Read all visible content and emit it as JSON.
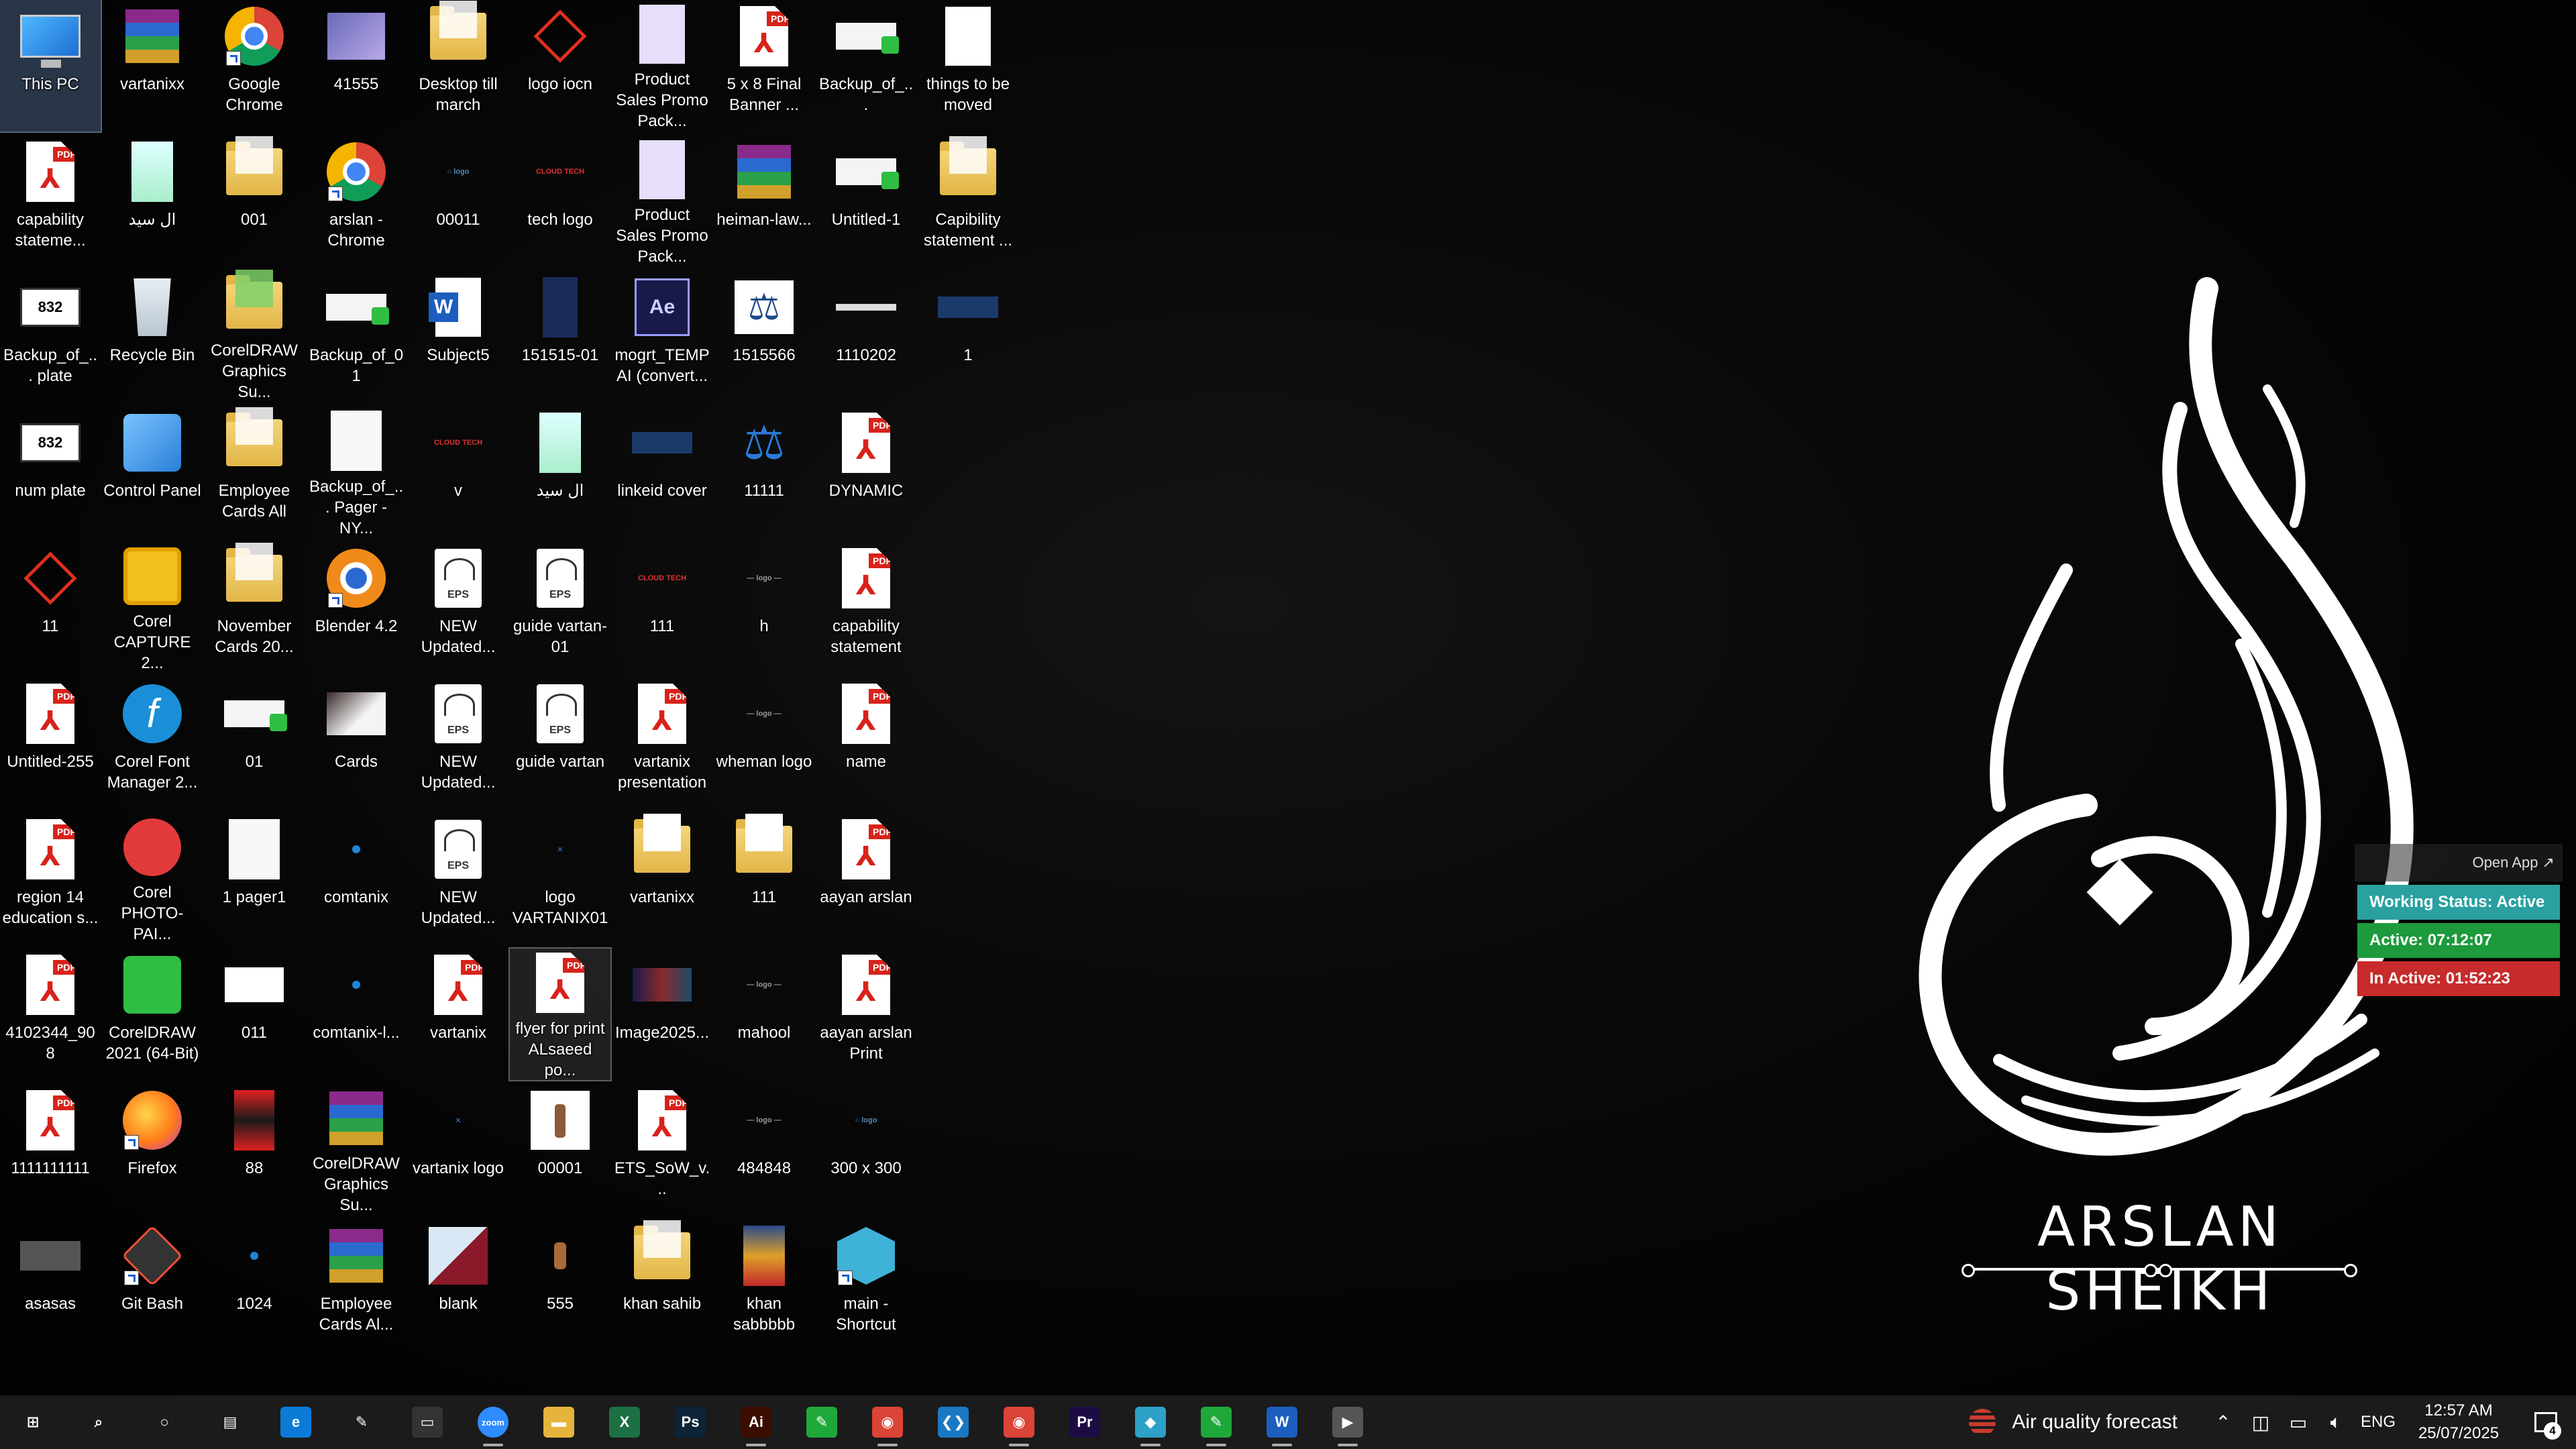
{
  "desktop": {
    "icons": [
      {
        "label": "This PC",
        "type": "pc",
        "col": 0,
        "row": 0,
        "selected": true
      },
      {
        "label": "vartanixx",
        "type": "rar",
        "col": 1,
        "row": 0
      },
      {
        "label": "Google Chrome",
        "type": "chrome",
        "col": 2,
        "row": 0,
        "shortcut": true
      },
      {
        "label": "41555",
        "type": "thumb-purple",
        "col": 3,
        "row": 0
      },
      {
        "label": "Desktop till march",
        "type": "folder",
        "col": 4,
        "row": 0
      },
      {
        "label": "logo iocn",
        "type": "logo-red",
        "col": 5,
        "row": 0
      },
      {
        "label": "Product Sales Promo Pack...",
        "type": "doc-lilac",
        "col": 6,
        "row": 0
      },
      {
        "label": "5 x 8 Final Banner ...",
        "type": "pdf",
        "col": 7,
        "row": 0
      },
      {
        "label": "Backup_of_...",
        "type": "thumb-cdr",
        "col": 8,
        "row": 0
      },
      {
        "label": "things to be moved",
        "type": "doc",
        "col": 9,
        "row": 0
      },
      {
        "label": "capability stateme...",
        "type": "pdf",
        "col": 0,
        "row": 1
      },
      {
        "label": "ال سيد",
        "type": "thumb-flyer",
        "col": 1,
        "row": 1
      },
      {
        "label": "001",
        "type": "folder",
        "col": 2,
        "row": 1
      },
      {
        "label": "arslan - Chrome",
        "type": "chrome",
        "col": 3,
        "row": 1,
        "shortcut": true
      },
      {
        "label": "00011",
        "type": "tiny-logo",
        "col": 4,
        "row": 1
      },
      {
        "label": "tech logo",
        "type": "tiny-red",
        "col": 5,
        "row": 1
      },
      {
        "label": "Product Sales Promo Pack...",
        "type": "doc-lilac",
        "col": 6,
        "row": 1
      },
      {
        "label": "heiman-law...",
        "type": "rar",
        "col": 7,
        "row": 1
      },
      {
        "label": "Untitled-1",
        "type": "thumb-cdr",
        "col": 8,
        "row": 1
      },
      {
        "label": "Capibility statement ...",
        "type": "folder",
        "col": 9,
        "row": 1
      },
      {
        "label": "Backup_of_... plate",
        "type": "thumb-plate",
        "col": 0,
        "row": 2
      },
      {
        "label": "Recycle Bin",
        "type": "bin",
        "col": 1,
        "row": 2
      },
      {
        "label": "CorelDRAW Graphics Su...",
        "type": "folder-blue",
        "col": 2,
        "row": 2
      },
      {
        "label": "Backup_of_01",
        "type": "thumb-cdr",
        "col": 3,
        "row": 2
      },
      {
        "label": "Subject5",
        "type": "word",
        "col": 4,
        "row": 2
      },
      {
        "label": "151515-01",
        "type": "thumb-navy",
        "col": 5,
        "row": 2
      },
      {
        "label": "mogrt_TEMP AI (convert...",
        "type": "ae",
        "col": 6,
        "row": 2
      },
      {
        "label": "1515566",
        "type": "scales-white",
        "col": 7,
        "row": 2
      },
      {
        "label": "1110202",
        "type": "thumb-line",
        "col": 8,
        "row": 2
      },
      {
        "label": "1",
        "type": "thumb-banner",
        "col": 9,
        "row": 2
      },
      {
        "label": "num plate",
        "type": "thumb-plate",
        "col": 0,
        "row": 3
      },
      {
        "label": "Control Panel",
        "type": "control",
        "col": 1,
        "row": 3
      },
      {
        "label": "Employee Cards All",
        "type": "folder",
        "col": 2,
        "row": 3
      },
      {
        "label": "Backup_of_... Pager - NY...",
        "type": "thumb-page",
        "col": 3,
        "row": 3
      },
      {
        "label": "v",
        "type": "tiny-red",
        "col": 4,
        "row": 3
      },
      {
        "label": "ال سيد",
        "type": "thumb-flyer",
        "col": 5,
        "row": 3
      },
      {
        "label": "linkeid cover",
        "type": "thumb-banner",
        "col": 6,
        "row": 3
      },
      {
        "label": "11111",
        "type": "scales-blue",
        "col": 7,
        "row": 3
      },
      {
        "label": "DYNAMIC",
        "type": "pdf",
        "col": 8,
        "row": 3
      },
      {
        "label": "11",
        "type": "logo-red",
        "col": 0,
        "row": 4
      },
      {
        "label": "Corel CAPTURE 2...",
        "type": "capture",
        "col": 1,
        "row": 4
      },
      {
        "label": "November Cards 20...",
        "type": "folder",
        "col": 2,
        "row": 4
      },
      {
        "label": "Blender 4.2",
        "type": "blender",
        "col": 3,
        "row": 4,
        "shortcut": true
      },
      {
        "label": "NEW Updated...",
        "type": "eps",
        "col": 4,
        "row": 4
      },
      {
        "label": "guide vartan-01",
        "type": "eps",
        "col": 5,
        "row": 4
      },
      {
        "label": "111",
        "type": "tiny-red",
        "col": 6,
        "row": 4
      },
      {
        "label": "h",
        "type": "tiny-gray",
        "col": 7,
        "row": 4
      },
      {
        "label": "capability statement",
        "type": "pdf",
        "col": 8,
        "row": 4
      },
      {
        "label": "Untitled-255",
        "type": "pdf",
        "col": 0,
        "row": 5
      },
      {
        "label": "Corel Font Manager 2...",
        "type": "fontmgr",
        "col": 1,
        "row": 5
      },
      {
        "label": "01",
        "type": "thumb-cdr",
        "col": 2,
        "row": 5
      },
      {
        "label": "Cards",
        "type": "thumb-cards",
        "col": 3,
        "row": 5
      },
      {
        "label": "NEW Updated...",
        "type": "eps",
        "col": 4,
        "row": 5
      },
      {
        "label": "guide vartan",
        "type": "eps",
        "col": 5,
        "row": 5
      },
      {
        "label": "vartanix presentation",
        "type": "pdf",
        "col": 6,
        "row": 5
      },
      {
        "label": "wheman logo",
        "type": "tiny-gray",
        "col": 7,
        "row": 5
      },
      {
        "label": "name",
        "type": "pdf",
        "col": 8,
        "row": 5
      },
      {
        "label": "region 14 education s...",
        "type": "pdf",
        "col": 0,
        "row": 6
      },
      {
        "label": "Corel PHOTO-PAI...",
        "type": "photopaint",
        "col": 1,
        "row": 6
      },
      {
        "label": "1 pager1",
        "type": "thumb-page",
        "col": 2,
        "row": 6
      },
      {
        "label": "comtanix",
        "type": "dot",
        "col": 3,
        "row": 6
      },
      {
        "label": "NEW Updated...",
        "type": "eps",
        "col": 4,
        "row": 6
      },
      {
        "label": "logo VARTANIX01",
        "type": "tiny-x",
        "col": 5,
        "row": 6
      },
      {
        "label": "vartanixx",
        "type": "folder-white",
        "col": 6,
        "row": 6
      },
      {
        "label": "111",
        "type": "folder-white",
        "col": 7,
        "row": 6
      },
      {
        "label": "aayan arslan",
        "type": "pdf",
        "col": 8,
        "row": 6
      },
      {
        "label": "4102344_908",
        "type": "pdf",
        "col": 0,
        "row": 7
      },
      {
        "label": "CorelDRAW 2021 (64-Bit)",
        "type": "coreldraw",
        "col": 1,
        "row": 7
      },
      {
        "label": "011",
        "type": "thumb-card",
        "col": 2,
        "row": 7
      },
      {
        "label": "comtanix-l...",
        "type": "dot",
        "col": 3,
        "row": 7
      },
      {
        "label": "vartanix",
        "type": "pdf",
        "col": 4,
        "row": 7
      },
      {
        "label": "flyer for print ALsaeed po...",
        "type": "pdf",
        "col": 5,
        "row": 7,
        "focus": true
      },
      {
        "label": "Image2025...",
        "type": "thumb-image",
        "col": 6,
        "row": 7
      },
      {
        "label": "mahool",
        "type": "tiny-gray",
        "col": 7,
        "row": 7
      },
      {
        "label": "aayan arslan Print",
        "type": "pdf",
        "col": 8,
        "row": 7
      },
      {
        "label": "1111111111",
        "type": "pdf",
        "col": 0,
        "row": 8
      },
      {
        "label": "Firefox",
        "type": "firefox",
        "col": 1,
        "row": 8,
        "shortcut": true
      },
      {
        "label": "88",
        "type": "thumb-red",
        "col": 2,
        "row": 8
      },
      {
        "label": "CorelDRAW Graphics Su...",
        "type": "rar",
        "col": 3,
        "row": 8
      },
      {
        "label": "vartanix logo",
        "type": "tiny-x",
        "col": 4,
        "row": 8
      },
      {
        "label": "00001",
        "type": "thumb-bottle",
        "col": 5,
        "row": 8
      },
      {
        "label": "ETS_SoW_v...",
        "type": "pdf",
        "col": 6,
        "row": 8
      },
      {
        "label": "484848",
        "type": "tiny-gray",
        "col": 7,
        "row": 8
      },
      {
        "label": "300 x 300",
        "type": "tiny-logo",
        "col": 8,
        "row": 8
      },
      {
        "label": "asasas",
        "type": "thumb-gray",
        "col": 0,
        "row": 9
      },
      {
        "label": "Git Bash",
        "type": "gitbash",
        "col": 1,
        "row": 9,
        "shortcut": true
      },
      {
        "label": "1024",
        "type": "dot",
        "col": 2,
        "row": 9
      },
      {
        "label": "Employee Cards Al...",
        "type": "rar",
        "col": 3,
        "row": 9
      },
      {
        "label": "blank",
        "type": "thumb-blank",
        "col": 4,
        "row": 9
      },
      {
        "label": "555",
        "type": "tiny-bottle",
        "col": 5,
        "row": 9
      },
      {
        "label": "khan sahib",
        "type": "folder",
        "col": 6,
        "row": 9
      },
      {
        "label": "khan sabbbbb",
        "type": "thumb-poster",
        "col": 7,
        "row": 9
      },
      {
        "label": "main - Shortcut",
        "type": "mainapp",
        "col": 8,
        "row": 9,
        "shortcut": true
      }
    ]
  },
  "wallpaper": {
    "brand_name": "ARSLAN SHEIKH"
  },
  "widget": {
    "open_label": "Open App ↗",
    "working_status": "Working Status: Active",
    "active": "Active: 07:12:07",
    "inactive": "In Active: 01:52:23"
  },
  "taskbar": {
    "apps": [
      {
        "name": "start-button",
        "glyph": "⊞",
        "color": "transparent"
      },
      {
        "name": "search-button",
        "glyph": "⌕",
        "color": "transparent"
      },
      {
        "name": "cortana-button",
        "glyph": "○",
        "color": "transparent"
      },
      {
        "name": "task-view-button",
        "glyph": "▤",
        "color": "transparent"
      },
      {
        "name": "edge-app",
        "glyph": "e",
        "color": "#0c7bd8"
      },
      {
        "name": "pen-app",
        "glyph": "✎",
        "color": "transparent"
      },
      {
        "name": "terminal-app",
        "glyph": "▭",
        "color": "#333"
      },
      {
        "name": "zoom-app",
        "glyph": "zoom",
        "color": "#2d8cff",
        "active": true
      },
      {
        "name": "file-explorer-app",
        "glyph": "▬",
        "color": "#e6b43c"
      },
      {
        "name": "excel-app",
        "glyph": "X",
        "color": "#1d7044"
      },
      {
        "name": "photoshop-app",
        "glyph": "Ps",
        "color": "#0d2338"
      },
      {
        "name": "illustrator-app",
        "glyph": "Ai",
        "color": "#3a0d00",
        "active": true
      },
      {
        "name": "coreldraw-app",
        "glyph": "✎",
        "color": "#1fa83a"
      },
      {
        "name": "chrome-app",
        "glyph": "◉",
        "color": "#db4437",
        "active": true
      },
      {
        "name": "vscode-app",
        "glyph": "❮❯",
        "color": "#1a78c2"
      },
      {
        "name": "chrome-profile-app",
        "glyph": "◉",
        "color": "#db4437",
        "active": true
      },
      {
        "name": "premiere-app",
        "glyph": "Pr",
        "color": "#1d0b44"
      },
      {
        "name": "main-app",
        "glyph": "◆",
        "color": "#2ea1c8",
        "active": true
      },
      {
        "name": "coreldraw2-app",
        "glyph": "✎",
        "color": "#1fa83a",
        "active": true
      },
      {
        "name": "word-app",
        "glyph": "W",
        "color": "#1b5ebe",
        "active": true
      },
      {
        "name": "media-app",
        "glyph": "▶",
        "color": "#555",
        "active": true
      }
    ],
    "air_quality": "Air quality forecast",
    "language": "ENG",
    "time": "12:57 AM",
    "date": "25/07/2025",
    "notifications": "4"
  }
}
